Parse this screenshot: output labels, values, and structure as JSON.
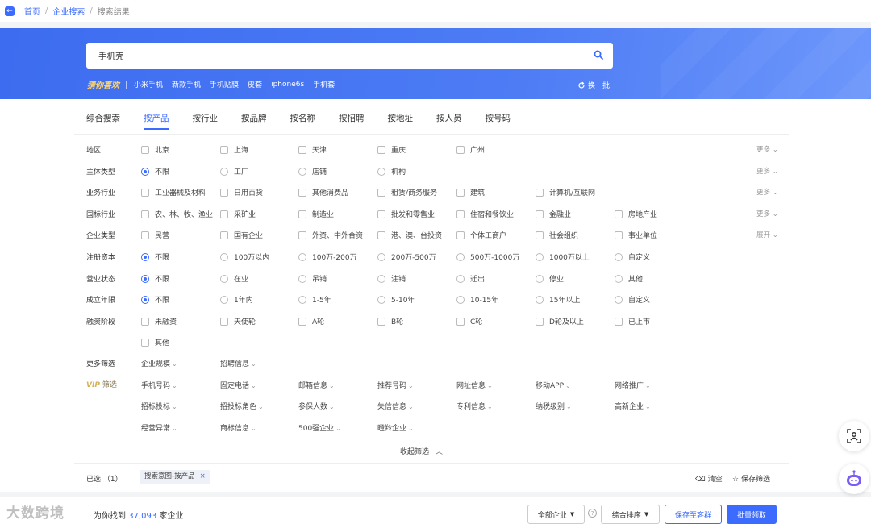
{
  "breadcrumb": {
    "home": "首页",
    "sep": "/",
    "mid": "企业搜索",
    "current": "搜索结果"
  },
  "search": {
    "value": "手机壳"
  },
  "hot": {
    "title": "猜你喜欢",
    "items": [
      "小米手机",
      "新款手机",
      "手机贴膜",
      "皮套",
      "iphone6s",
      "手机套"
    ],
    "refresh": "换一批"
  },
  "tabs": [
    "综合搜索",
    "按产品",
    "按行业",
    "按品牌",
    "按名称",
    "按招聘",
    "按地址",
    "按人员",
    "按号码"
  ],
  "active_tab": "按产品",
  "filters": {
    "region": {
      "label": "地区",
      "options": [
        "北京",
        "上海",
        "天津",
        "重庆",
        "广州"
      ],
      "more": "更多"
    },
    "entity": {
      "label": "主体类型",
      "options": [
        "不限",
        "工厂",
        "店铺",
        "机构"
      ],
      "more": "更多"
    },
    "business": {
      "label": "业务行业",
      "options": [
        "工业器械及材料",
        "日用百货",
        "其他消费品",
        "租赁/商务服务",
        "建筑",
        "计算机/互联网"
      ],
      "more": "更多"
    },
    "national": {
      "label": "国标行业",
      "options": [
        "农、林、牧、渔业",
        "采矿业",
        "制造业",
        "批发和零售业",
        "住宿和餐饮业",
        "金融业",
        "房地产业"
      ],
      "more": "更多"
    },
    "company_type": {
      "label": "企业类型",
      "options": [
        "民营",
        "国有企业",
        "外资、中外合资",
        "港、澳、台投资",
        "个体工商户",
        "社会组织",
        "事业单位"
      ],
      "more": "展开"
    },
    "capital": {
      "label": "注册资本",
      "options": [
        "不限",
        "100万以内",
        "100万-200万",
        "200万-500万",
        "500万-1000万",
        "1000万以上",
        "自定义"
      ]
    },
    "status": {
      "label": "营业状态",
      "options": [
        "不限",
        "在业",
        "吊销",
        "注销",
        "迁出",
        "停业",
        "其他"
      ]
    },
    "years": {
      "label": "成立年限",
      "options": [
        "不限",
        "1年内",
        "1-5年",
        "5-10年",
        "10-15年",
        "15年以上",
        "自定义"
      ]
    },
    "funding": {
      "label": "融资阶段",
      "options": [
        "未融资",
        "天使轮",
        "A轮",
        "B轮",
        "C轮",
        "D轮及以上",
        "已上市",
        "其他"
      ]
    },
    "more_filters": {
      "label": "更多筛选",
      "options": [
        "企业规模",
        "招聘信息"
      ]
    },
    "vip": {
      "badge": "VIP",
      "label": "筛选",
      "row1": [
        "手机号码",
        "固定电话",
        "邮箱信息",
        "推荐号码",
        "网址信息",
        "移动APP",
        "网络推广"
      ],
      "row2": [
        "招标投标",
        "招投标角色",
        "参保人数",
        "失信信息",
        "专利信息",
        "纳税级别",
        "高新企业"
      ],
      "row3": [
        "经营异常",
        "商标信息",
        "500强企业",
        "瞪羚企业"
      ]
    }
  },
  "collapse_label": "收起筛选",
  "selected": {
    "label": "已选 （1）",
    "tag": "搜索意图-按产品",
    "tag_close": "×",
    "clear": "清空",
    "save": "保存筛选"
  },
  "result": {
    "prefix": "为你找到",
    "count": "37,093",
    "suffix": "家企业"
  },
  "watermark": "大数跨境",
  "buttons": {
    "all_companies": "全部企业",
    "help": "?",
    "sort": "综合排序",
    "save_group": "保存至客群",
    "batch": "批量领取"
  },
  "colors": {
    "primary": "#3b6bff",
    "vip": "#d7b15a"
  }
}
